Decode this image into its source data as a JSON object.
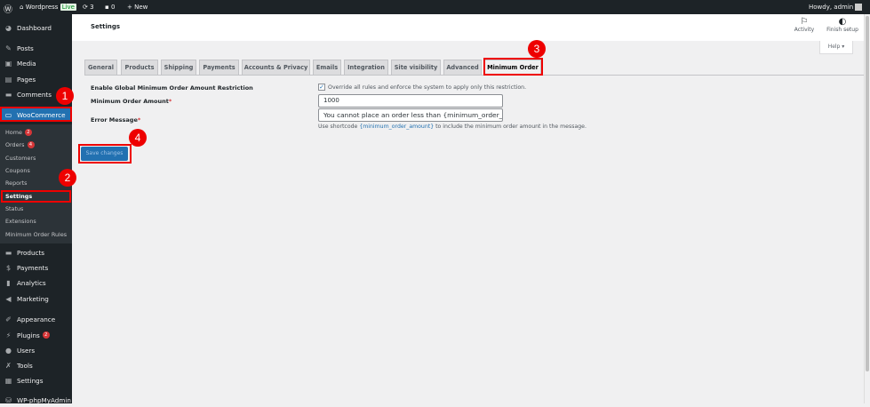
{
  "adminbar": {
    "site": "Wordpress",
    "live": "Live",
    "updates": "3",
    "comments": "0",
    "new": "New",
    "howdy": "Howdy, admin"
  },
  "sidebar": {
    "items": [
      {
        "label": "Dashboard",
        "icon": "dashboard-icon"
      },
      {
        "label": "Posts",
        "icon": "pin-icon"
      },
      {
        "label": "Media",
        "icon": "media-icon"
      },
      {
        "label": "Pages",
        "icon": "pages-icon"
      },
      {
        "label": "Comments",
        "icon": "comment-icon"
      },
      {
        "label": "WooCommerce",
        "icon": "woo-icon"
      }
    ],
    "submenu": [
      {
        "label": "Home",
        "badge": "2"
      },
      {
        "label": "Orders",
        "badge": "4"
      },
      {
        "label": "Customers"
      },
      {
        "label": "Coupons"
      },
      {
        "label": "Reports"
      },
      {
        "label": "Settings"
      },
      {
        "label": "Status"
      },
      {
        "label": "Extensions"
      },
      {
        "label": "Minimum Order Rules"
      }
    ],
    "items2": [
      {
        "label": "Products"
      },
      {
        "label": "Payments"
      },
      {
        "label": "Analytics"
      },
      {
        "label": "Marketing"
      },
      {
        "label": "Appearance"
      },
      {
        "label": "Plugins",
        "badge": "2"
      },
      {
        "label": "Users"
      },
      {
        "label": "Tools"
      },
      {
        "label": "Settings"
      },
      {
        "label": "WP-phpMyAdmin"
      }
    ]
  },
  "header": {
    "title": "Settings",
    "activity": "Activity",
    "finish_setup": "Finish setup",
    "help": "Help ▾"
  },
  "tabs": [
    "General",
    "Products",
    "Shipping",
    "Payments",
    "Accounts & Privacy",
    "Emails",
    "Integration",
    "Site visibility",
    "Advanced",
    "Minimum Order"
  ],
  "form": {
    "enable_label": "Enable Global Minimum Order Amount Restriction",
    "enable_desc": "Override all rules and enforce the system to apply only this restriction.",
    "enable_checked": true,
    "amount_label": "Minimum Order Amount",
    "amount_value": "1000",
    "error_label": "Error Message",
    "error_value": "You cannot place an order less than {minimum_order_amount}",
    "help_pre": "Use shortcode ",
    "help_code": "{minimum_order_amount}",
    "help_post": " to include the minimum order amount in the message.",
    "required": "*",
    "save": "Save changes"
  },
  "annotations": [
    "1",
    "2",
    "3",
    "4"
  ],
  "colors": {
    "accent": "#2271b1",
    "annotation": "#ee0000"
  }
}
